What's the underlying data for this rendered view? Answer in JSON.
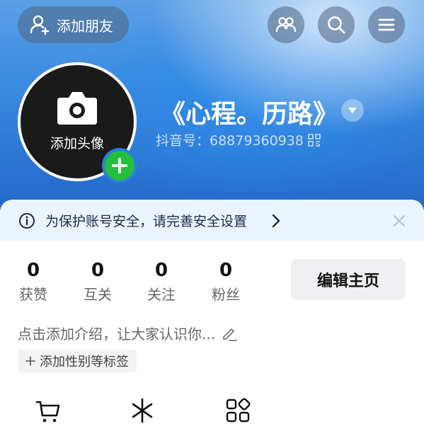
{
  "header": {
    "add_friend_label": "添加朋友",
    "icons": [
      "friends-icon",
      "search-icon",
      "menu-icon"
    ]
  },
  "profile": {
    "avatar_label": "添加头像",
    "nickname": "《心程。历路》",
    "douyin_id": "抖音号：68879360938"
  },
  "security_banner": {
    "text": "为保护账号安全，请完善安全设置"
  },
  "stats": [
    {
      "value": "0",
      "label": "获赞"
    },
    {
      "value": "0",
      "label": "互关"
    },
    {
      "value": "0",
      "label": "关注"
    },
    {
      "value": "0",
      "label": "粉丝"
    }
  ],
  "edit_profile_label": "编辑主页",
  "bio_placeholder": "点击添加介绍，让大家认识你...",
  "tag_label": "添加性别等标签",
  "tools": [
    "cart-icon",
    "sparkle-icon",
    "apps-icon"
  ],
  "colors": {
    "header_blue": "#2b74d2",
    "avatar_plus_green": "#24bf3c",
    "security_bg": "#eaf4ff"
  }
}
